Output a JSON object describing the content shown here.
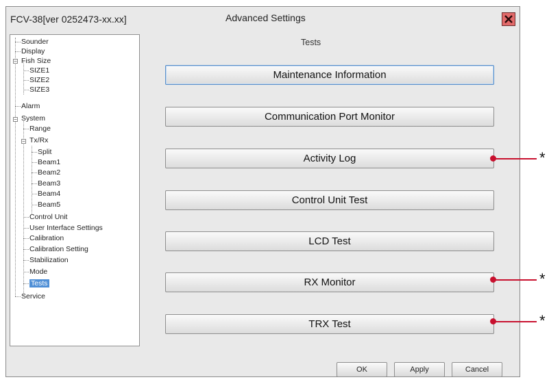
{
  "window": {
    "app_title": "FCV-38[ver 0252473-xx.xx]",
    "dialog_title": "Advanced Settings",
    "close_icon": "close-icon"
  },
  "tree": {
    "items": [
      {
        "label": "Sounder"
      },
      {
        "label": "Display"
      },
      {
        "label": "Fish Size"
      },
      {
        "label": "SIZE1"
      },
      {
        "label": "SIZE2"
      },
      {
        "label": "SIZE3"
      },
      {
        "label": "Alarm"
      },
      {
        "label": "System"
      },
      {
        "label": "Range"
      },
      {
        "label": "Tx/Rx"
      },
      {
        "label": "Split"
      },
      {
        "label": "Beam1"
      },
      {
        "label": "Beam2"
      },
      {
        "label": "Beam3"
      },
      {
        "label": "Beam4"
      },
      {
        "label": "Beam5"
      },
      {
        "label": "Control Unit"
      },
      {
        "label": "User Interface Settings"
      },
      {
        "label": "Calibration"
      },
      {
        "label": "Calibration Setting"
      },
      {
        "label": "Stabilization"
      },
      {
        "label": "Mode"
      },
      {
        "label": "Tests",
        "selected": true
      },
      {
        "label": "Service"
      }
    ]
  },
  "panel": {
    "title": "Tests",
    "buttons": [
      {
        "label": "Maintenance Information"
      },
      {
        "label": "Communication Port Monitor"
      },
      {
        "label": "Activity Log"
      },
      {
        "label": "Control Unit Test"
      },
      {
        "label": "LCD Test"
      },
      {
        "label": "RX Monitor"
      },
      {
        "label": "TRX Test"
      }
    ]
  },
  "footer": {
    "ok_label": "OK",
    "apply_label": "Apply",
    "cancel_label": "Cancel"
  },
  "annotations": {
    "marker": "*",
    "color": "#c8102e"
  }
}
